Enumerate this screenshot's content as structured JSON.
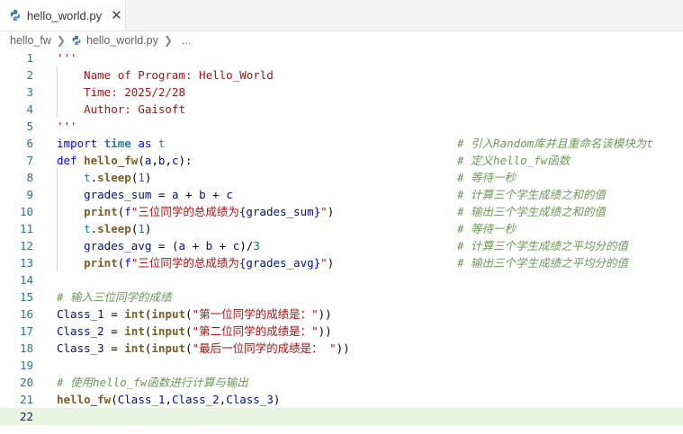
{
  "tab": {
    "filename": "hello_world.py"
  },
  "breadcrumb": {
    "folder": "hello_fw",
    "file": "hello_world.py",
    "ellipsis": "..."
  },
  "lines": [
    {
      "n": "1",
      "code": "'''",
      "comment": ""
    },
    {
      "n": "2",
      "code": "    Name of Program: Hello_World",
      "comment": ""
    },
    {
      "n": "3",
      "code": "    Time: 2025/2/28",
      "comment": ""
    },
    {
      "n": "4",
      "code": "    Author: Gaisoft",
      "comment": ""
    },
    {
      "n": "5",
      "code": "'''",
      "comment": ""
    },
    {
      "n": "6",
      "code": "import time as t",
      "comment": "# 引入Random库并且重命名该模块为t"
    },
    {
      "n": "7",
      "code": "def hello_fw(a,b,c):",
      "comment": "# 定义hello_fw函数"
    },
    {
      "n": "8",
      "code": "    t.sleep(1)",
      "comment": "# 等待一秒"
    },
    {
      "n": "9",
      "code": "    grades_sum = a + b + c",
      "comment": "# 计算三个学生成绩之和的值"
    },
    {
      "n": "10",
      "code": "    print(f\"三位同学的总成绩为{grades_sum}\")",
      "comment": "# 输出三个学生成绩之和的值"
    },
    {
      "n": "11",
      "code": "    t.sleep(1)",
      "comment": "# 等待一秒"
    },
    {
      "n": "12",
      "code": "    grades_avg = (a + b + c)/3",
      "comment": "# 计算三个学生成绩之平均分的值"
    },
    {
      "n": "13",
      "code": "    print(f\"三位同学的总成绩为{grades_avg}\")",
      "comment": "# 输出三个学生成绩之平均分的值"
    },
    {
      "n": "14",
      "code": "",
      "comment": ""
    },
    {
      "n": "15",
      "code": "# 输入三位同学的成绩",
      "comment": ""
    },
    {
      "n": "16",
      "code": "Class_1 = int(input(\"第一位同学的成绩是：\"))",
      "comment": ""
    },
    {
      "n": "17",
      "code": "Class_2 = int(input(\"第二位同学的成绩是：\"))",
      "comment": ""
    },
    {
      "n": "18",
      "code": "Class_3 = int(input(\"最后一位同学的成绩是： \"))",
      "comment": ""
    },
    {
      "n": "19",
      "code": "",
      "comment": ""
    },
    {
      "n": "20",
      "code": "# 使用hello_fw函数进行计算与输出",
      "comment": ""
    },
    {
      "n": "21",
      "code": "hello_fw(Class_1,Class_2,Class_3)",
      "comment": ""
    },
    {
      "n": "22",
      "code": "",
      "comment": ""
    }
  ],
  "current_line": "22",
  "colors": {
    "line_number": "#237893",
    "comment": "#6a9955",
    "string": "#a31515",
    "keyword": "#0000ff",
    "function": "#795e26",
    "variable": "#001080",
    "number": "#098658",
    "current_line_bg": "#e8f5e1"
  }
}
